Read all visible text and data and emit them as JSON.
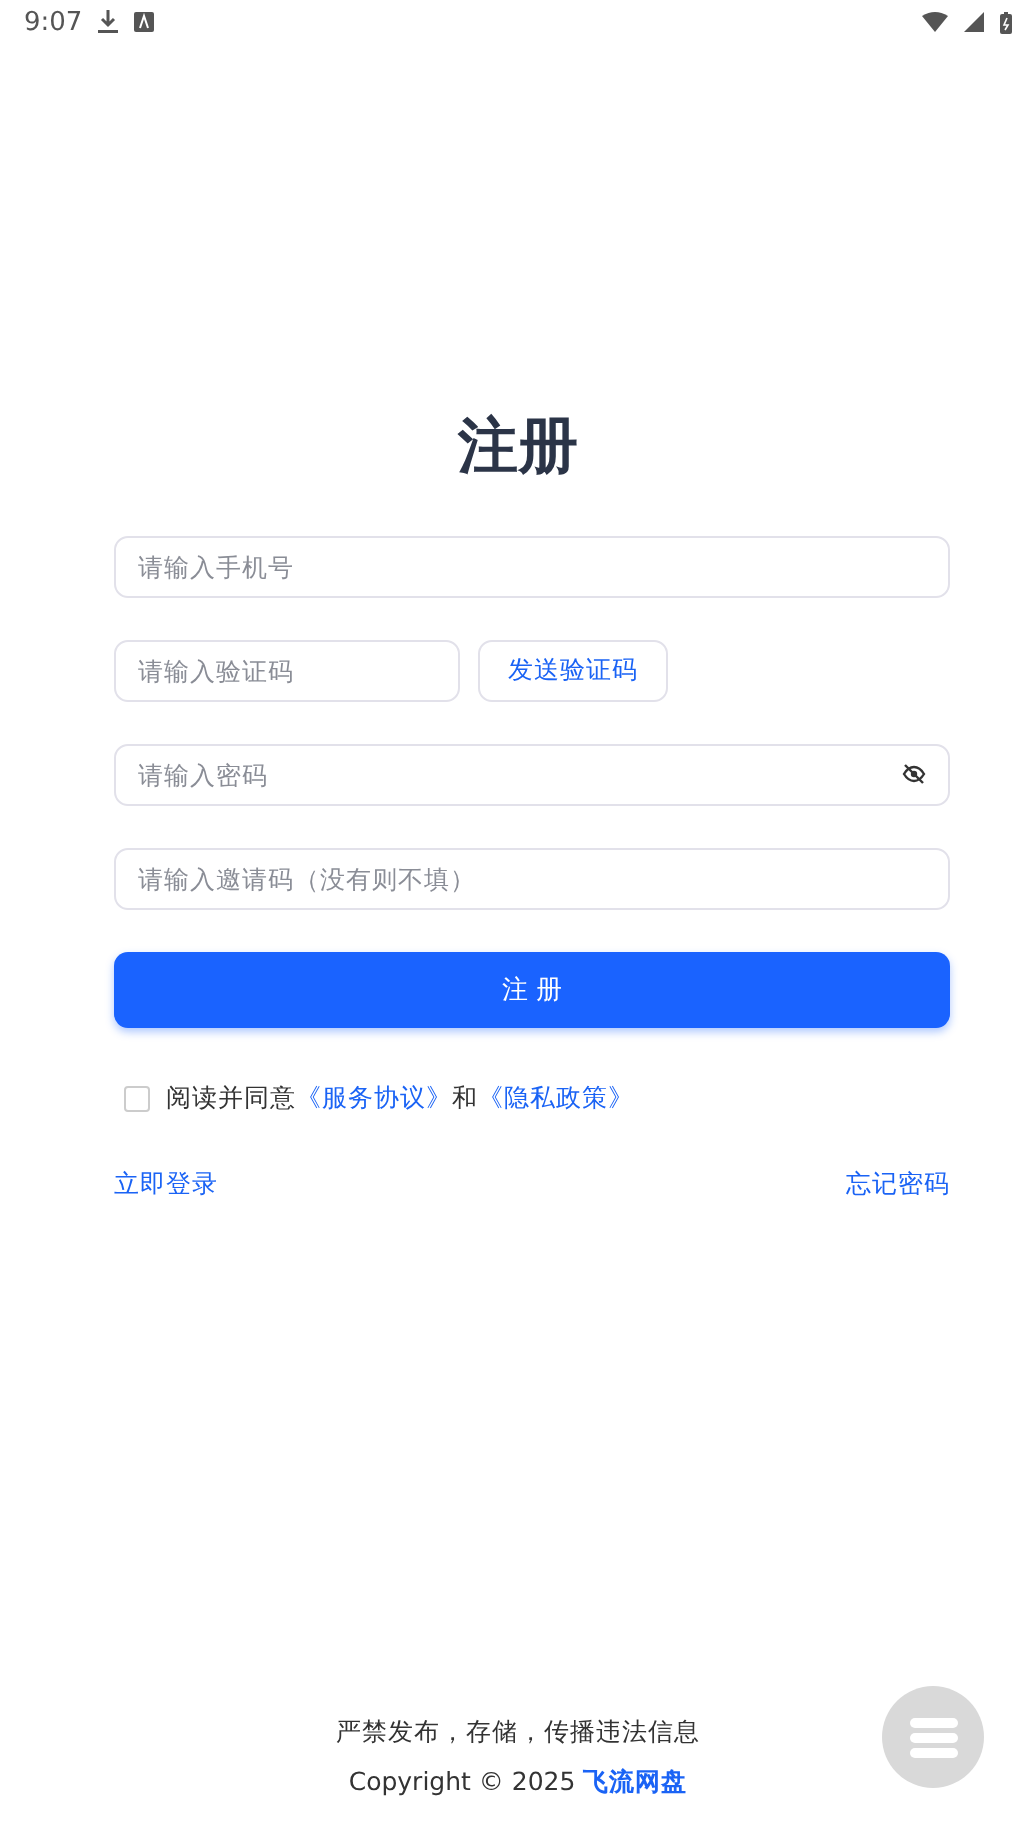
{
  "status_bar": {
    "time": "9:07"
  },
  "title": "注册",
  "fields": [
    {
      "kind": "phone",
      "placeholder": "请输入手机号"
    },
    {
      "kind": "code",
      "placeholder": "请输入验证码",
      "button": "发送验证码"
    },
    {
      "kind": "password",
      "placeholder": "请输入密码"
    },
    {
      "kind": "invite",
      "placeholder": "请输入邀请码（没有则不填）"
    }
  ],
  "submit_button": "注 册",
  "agreement": {
    "checked": false,
    "text_before": "阅读并同意",
    "link_1": "《服务协议》",
    "text_middle": "和",
    "link_2": "《隐私政策》"
  },
  "links": {
    "login": "立即登录",
    "forgot": "忘记密码"
  },
  "footer": {
    "notice": "严禁发布，存储，传播违法信息",
    "copyright": "Copyright © 2025 ",
    "brand": "飞流网盘"
  }
}
